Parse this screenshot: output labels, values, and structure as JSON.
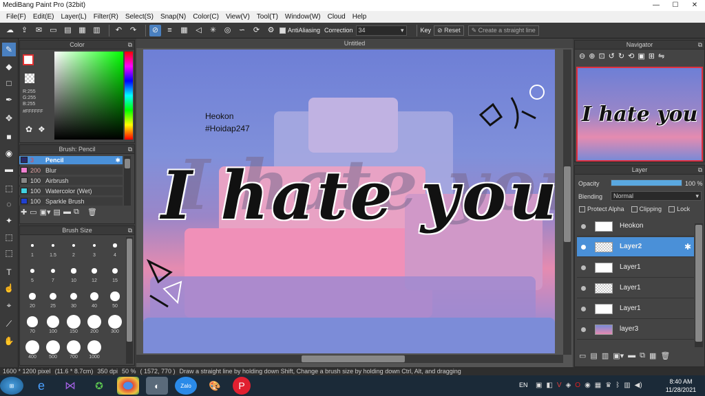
{
  "titlebar": {
    "title": "MediBang Paint Pro (32bit)",
    "minimize": "—",
    "maximize": "☐",
    "close": "✕"
  },
  "menu": [
    "File(F)",
    "Edit(E)",
    "Layer(L)",
    "Filter(R)",
    "Select(S)",
    "Snap(N)",
    "Color(C)",
    "View(V)",
    "Tool(T)",
    "Window(W)",
    "Cloud",
    "Help"
  ],
  "toolbar": {
    "antialiasing": "AntiAliasing",
    "correction_label": "Correction",
    "correction_value": "34",
    "key_label": "Key",
    "reset_label": "Reset",
    "straight_line_label": "Create a straight line"
  },
  "color_panel": {
    "title": "Color",
    "r": "R:255",
    "g": "G:255",
    "b": "B:255",
    "hex": "#FFFFFF",
    "primary": "#ffffff",
    "secondary": "#e03030"
  },
  "brush_panel": {
    "title": "Brush: Pencil",
    "items": [
      {
        "size": "3",
        "name": "Pencil",
        "color": "#2a2a6a",
        "selected": true
      },
      {
        "size": "200",
        "name": "Blur",
        "color": "#f080d0"
      },
      {
        "size": "100",
        "name": "Airbrush",
        "color": "#888888"
      },
      {
        "size": "100",
        "name": "Watercolor (Wet)",
        "color": "#40d0e0"
      },
      {
        "size": "100",
        "name": "Sparkle Brush",
        "color": "#2040d0"
      }
    ]
  },
  "brush_size_panel": {
    "title": "Brush Size",
    "sizes": [
      "1",
      "1.5",
      "2",
      "3",
      "4",
      "5",
      "7",
      "10",
      "12",
      "15",
      "20",
      "25",
      "30",
      "40",
      "50",
      "70",
      "100",
      "150",
      "200",
      "300",
      "400",
      "500",
      "700",
      "1000"
    ]
  },
  "canvas": {
    "tab_title": "Untitled",
    "author_name": "Heokon",
    "author_tag": "#Hoidap247",
    "main_text": "I hate you"
  },
  "navigator": {
    "title": "Navigator",
    "preview_text": "I hate you"
  },
  "layer_panel": {
    "title": "Layer",
    "opacity_label": "Opacity",
    "opacity_value": "100 %",
    "opacity_fraction": 1.0,
    "blending_label": "Blending",
    "blending_value": "Normal",
    "protect_alpha": "Protect Alpha",
    "clipping": "Clipping",
    "lock": "Lock",
    "layers": [
      {
        "name": "Heokon",
        "thumb": "Heokon\n#Hoidap247",
        "selected": false
      },
      {
        "name": "Layer2",
        "thumb": "",
        "selected": true
      },
      {
        "name": "Layer1",
        "thumb": "I hate you",
        "selected": false
      },
      {
        "name": "Layer1",
        "thumb": "",
        "selected": false
      },
      {
        "name": "Layer1",
        "thumb": "I hate you",
        "selected": false
      },
      {
        "name": "layer3",
        "thumb": "",
        "selected": false
      }
    ]
  },
  "status": {
    "dimensions": "1600 * 1200 pixel",
    "physical": "(11.6 * 8.7cm)",
    "dpi": "350 dpi",
    "zoom": "50 %",
    "coords": "( 1572, 770 )",
    "hint": "Draw a straight line by holding down Shift, Change a brush size by holding down Ctrl, Alt, and dragging"
  },
  "taskbar": {
    "time": "8:40 AM",
    "date": "11/28/2021",
    "lang": "EN",
    "zalo": "Zalo"
  }
}
